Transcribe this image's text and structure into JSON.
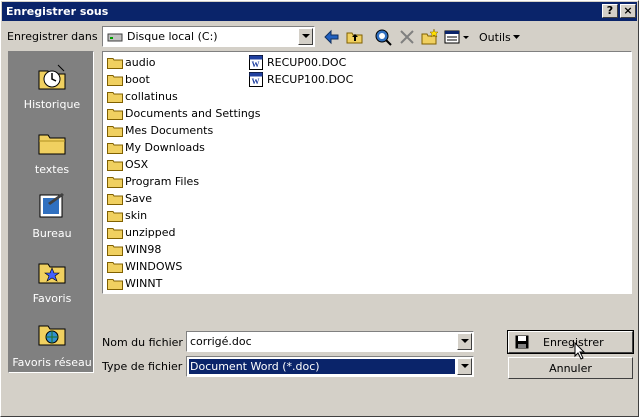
{
  "window": {
    "title": "Enregistrer sous",
    "help_button": "?",
    "close_button": "×"
  },
  "toolbar": {
    "save_in_label": "Enregistrer dans :",
    "location": "Disque local (C:)",
    "tools_label": "Outils"
  },
  "places": [
    {
      "label": "Historique",
      "icon": "history-icon"
    },
    {
      "label": "textes",
      "icon": "folder-icon"
    },
    {
      "label": "Bureau",
      "icon": "desktop-icon"
    },
    {
      "label": "Favoris",
      "icon": "favorites-icon"
    },
    {
      "label": "Favoris réseau",
      "icon": "network-icon"
    }
  ],
  "files": {
    "folders": [
      "audio",
      "boot",
      "collatinus",
      "Documents and Settings",
      "Mes Documents",
      "My Downloads",
      "OSX",
      "Program Files",
      "Save",
      "skin",
      "unzipped",
      "WIN98",
      "WINDOWS",
      "WINNT"
    ],
    "documents": [
      "RECUP00.DOC",
      "RECUP100.DOC"
    ]
  },
  "form": {
    "filename_label": "Nom du fichier :",
    "filename_value": "corrigé.doc",
    "filetype_label": "Type de fichier :",
    "filetype_value": "Document Word (*.doc)"
  },
  "buttons": {
    "save": "Enregistrer",
    "cancel": "Annuler"
  },
  "colors": {
    "titlebar": "#0a246a",
    "places_bar": "#808080",
    "selection": "#0a246a",
    "face": "#d4d0c8"
  }
}
